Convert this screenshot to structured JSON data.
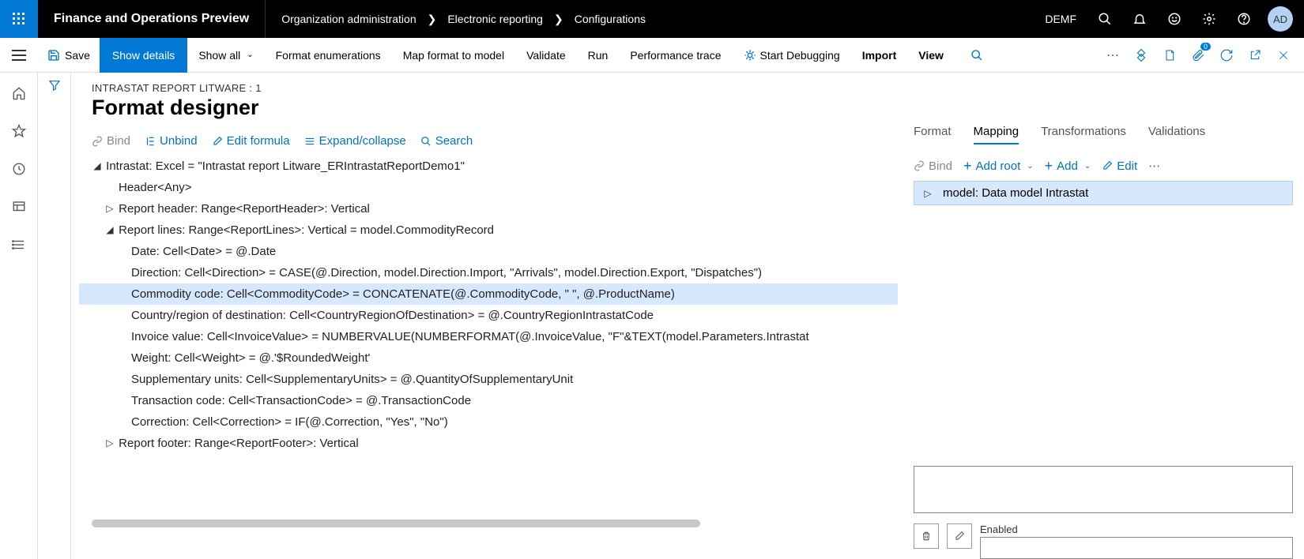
{
  "app_title": "Finance and Operations Preview",
  "breadcrumbs": [
    "Organization administration",
    "Electronic reporting",
    "Configurations"
  ],
  "company": "DEMF",
  "avatar": "AD",
  "cmdbar": {
    "save": "Save",
    "show_details": "Show details",
    "show_all": "Show all",
    "format_enum": "Format enumerations",
    "map": "Map format to model",
    "validate": "Validate",
    "run": "Run",
    "perf": "Performance trace",
    "debug": "Start Debugging",
    "import": "Import",
    "view": "View",
    "badge": "0"
  },
  "page": {
    "sub": "INTRASTAT REPORT LITWARE : 1",
    "title": "Format designer"
  },
  "toolbar": {
    "bind": "Bind",
    "unbind": "Unbind",
    "edit_formula": "Edit formula",
    "expand": "Expand/collapse",
    "search": "Search"
  },
  "tree": {
    "root": "Intrastat: Excel = \"Intrastat report Litware_ERIntrastatReportDemo1\"",
    "header": "Header<Any>",
    "report_header": "Report header: Range<ReportHeader>: Vertical",
    "report_lines": "Report lines: Range<ReportLines>: Vertical = model.CommodityRecord",
    "lines": {
      "date": "Date: Cell<Date> = @.Date",
      "direction": "Direction: Cell<Direction> = CASE(@.Direction, model.Direction.Import, \"Arrivals\", model.Direction.Export, \"Dispatches\")",
      "commodity": "Commodity code: Cell<CommodityCode> = CONCATENATE(@.CommodityCode, \" \", @.ProductName)",
      "country": "Country/region of destination: Cell<CountryRegionOfDestination> = @.CountryRegionIntrastatCode",
      "invoice": "Invoice value: Cell<InvoiceValue> = NUMBERVALUE(NUMBERFORMAT(@.InvoiceValue, \"F\"&TEXT(model.Parameters.Intrastat",
      "weight": "Weight: Cell<Weight> = @.'$RoundedWeight'",
      "supp": "Supplementary units: Cell<SupplementaryUnits> = @.QuantityOfSupplementaryUnit",
      "trans": "Transaction code: Cell<TransactionCode> = @.TransactionCode",
      "corr": "Correction: Cell<Correction> = IF(@.Correction, \"Yes\", \"No\")"
    },
    "report_footer": "Report footer: Range<ReportFooter>: Vertical"
  },
  "right": {
    "tabs": {
      "format": "Format",
      "mapping": "Mapping",
      "transformations": "Transformations",
      "validations": "Validations"
    },
    "toolbar": {
      "bind": "Bind",
      "add_root": "Add root",
      "add": "Add",
      "edit": "Edit"
    },
    "model_row": "model: Data model Intrastat",
    "enabled_label": "Enabled"
  }
}
